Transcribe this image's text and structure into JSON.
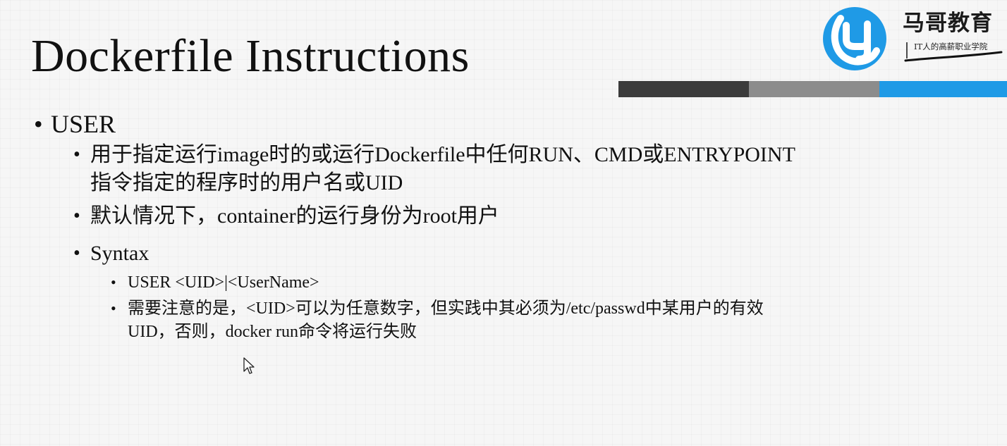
{
  "slide": {
    "title": "Dockerfile Instructions",
    "bullets": {
      "main": "USER",
      "b1_line1": "用于指定运行image时的或运行Dockerfile中任何RUN、CMD或ENTRYPOINT",
      "b1_line2": "指令指定的程序时的用户名或UID",
      "b2": "默认情况下，container的运行身份为root用户",
      "b3": "Syntax",
      "s1": "USER <UID>|<UserName>",
      "s2_line1": "需要注意的是，<UID>可以为任意数字，但实践中其必须为/etc/passwd中某用户的有效",
      "s2_line2": "UID，否则，docker run命令将运行失败"
    }
  },
  "logo": {
    "name": "马哥教育",
    "slogan": "IT人的高薪职业学院",
    "colors": {
      "blue": "#1f9ae6"
    }
  },
  "accent_bar": {
    "colors": [
      "#3b3b3b",
      "#8c8c8c",
      "#1f9ae6"
    ]
  },
  "icons": {
    "bullet": "•",
    "cursor": "mouse-pointer-icon"
  }
}
